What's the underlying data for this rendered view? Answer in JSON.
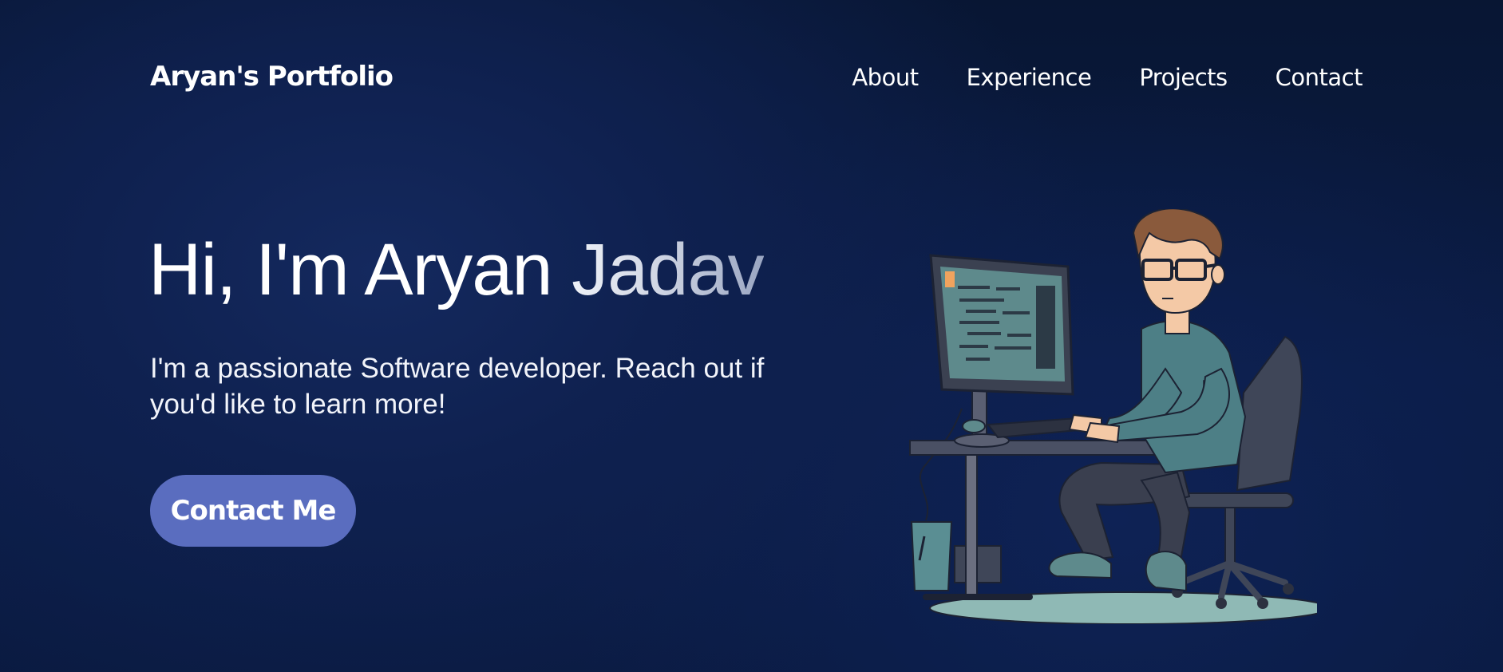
{
  "nav": {
    "brand": "Aryan's Portfolio",
    "links": [
      "About",
      "Experience",
      "Projects",
      "Contact"
    ]
  },
  "hero": {
    "title_lead": "Hi, I'm Aryan ",
    "title_tail": "Jadav",
    "subtitle": "I'm a passionate Software developer. Reach out if you'd like to learn more!",
    "cta_label": "Contact Me",
    "illustration_icon": "developer-at-computer-illustration"
  },
  "colors": {
    "background": "#0b1c46",
    "accent": "#5a6dbf",
    "text": "#ffffff"
  }
}
